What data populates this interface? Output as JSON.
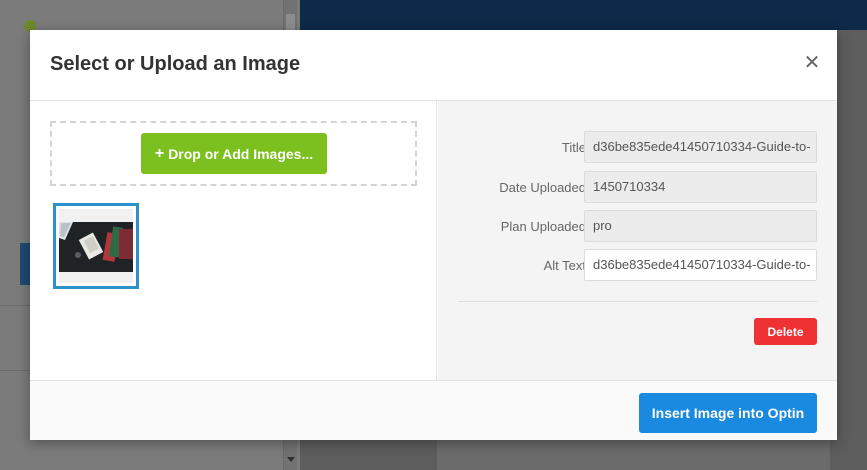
{
  "modal": {
    "title": "Select or Upload an Image",
    "close_icon": "close-icon",
    "close_glyph": "✕"
  },
  "upload": {
    "button_label": "Drop or Add Images...",
    "plus_glyph": "+",
    "button_color": "#7bc01e"
  },
  "gallery": {
    "selected_border_color": "#2d91c9"
  },
  "details": {
    "fields": [
      {
        "label": "Title",
        "value": "d36be835ede41450710334-Guide-to-"
      },
      {
        "label": "Date Uploaded",
        "value": "1450710334"
      },
      {
        "label": "Plan Uploaded",
        "value": "pro"
      },
      {
        "label": "Alt Text",
        "value": "d36be835ede41450710334-Guide-to-"
      }
    ],
    "delete_label": "Delete",
    "delete_color": "#ee3233"
  },
  "footer": {
    "insert_label": "Insert Image into Optin",
    "insert_color": "#1a89e0"
  }
}
